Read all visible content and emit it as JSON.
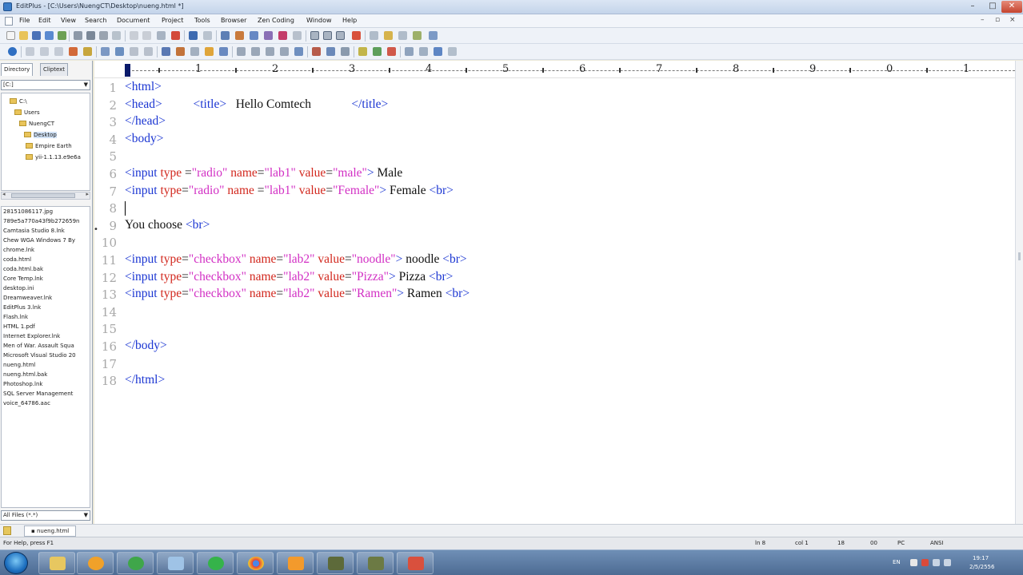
{
  "window": {
    "title": "EditPlus - [C:\\Users\\NuengCT\\Desktop\\nueng.html *]",
    "minimize": "–",
    "maximize": "□",
    "close": "✕"
  },
  "menu": [
    "File",
    "Edit",
    "View",
    "Search",
    "Document",
    "Project",
    "Tools",
    "Browser",
    "Zen Coding",
    "Window",
    "Help"
  ],
  "panel": {
    "tabs": [
      "Directory",
      "Cliptext"
    ],
    "drive": "[C:]",
    "tree": [
      {
        "label": "C:\\",
        "indent": 0
      },
      {
        "label": "Users",
        "indent": 1
      },
      {
        "label": "NuengCT",
        "indent": 2
      },
      {
        "label": "Desktop",
        "indent": 3
      },
      {
        "label": "Empire Earth",
        "indent": 4
      },
      {
        "label": "yii-1.1.13.e9e6a",
        "indent": 4
      }
    ],
    "files": [
      "28151086117.jpg",
      "789e5a770a43f9b272659n",
      "Camtasia Studio 8.lnk",
      "Chew WGA Windows 7 By",
      "chrome.lnk",
      "coda.html",
      "coda.html.bak",
      "Core Temp.lnk",
      "desktop.ini",
      "Dreamweaver.lnk",
      "EditPlus 3.lnk",
      "Flash.lnk",
      "HTML 1.pdf",
      "Internet Explorer.lnk",
      "Men of War. Assault Squa",
      "Microsoft Visual Studio 20",
      "nueng.html",
      "nueng.html.bak",
      "Photoshop.lnk",
      "SQL Server Management",
      "voice_64786.aac"
    ],
    "filter": "All Files (*.*)"
  },
  "editor": {
    "ruler": [
      "1",
      "2",
      "3",
      "4",
      "5",
      "6",
      "7",
      "8",
      "9",
      "0",
      "1"
    ],
    "lines": [
      {
        "n": "1",
        "segs": [
          [
            "t",
            "<html>"
          ]
        ]
      },
      {
        "n": "2",
        "segs": [
          [
            "t",
            "<head>"
          ],
          [
            "",
            "          "
          ],
          [
            "t",
            "<title>"
          ],
          [
            "",
            "   Hello Comtech             "
          ],
          [
            "t",
            "</title>"
          ]
        ]
      },
      {
        "n": "3",
        "segs": [
          [
            "t",
            "</head>"
          ]
        ]
      },
      {
        "n": "4",
        "segs": [
          [
            "t",
            "<body>"
          ]
        ]
      },
      {
        "n": "5",
        "segs": []
      },
      {
        "n": "6",
        "segs": [
          [
            "t",
            "<input "
          ],
          [
            "a",
            "type"
          ],
          [
            "",
            " ="
          ],
          [
            "v",
            "\"radio\""
          ],
          [
            "",
            " "
          ],
          [
            "a",
            "name"
          ],
          [
            "",
            "="
          ],
          [
            "v",
            "\"lab1\""
          ],
          [
            "",
            " "
          ],
          [
            "a",
            "value"
          ],
          [
            "",
            "="
          ],
          [
            "v",
            "\"male\""
          ],
          [
            "t",
            ">"
          ],
          [
            "",
            " Male"
          ]
        ]
      },
      {
        "n": "7",
        "segs": [
          [
            "t",
            "<input "
          ],
          [
            "a",
            "type"
          ],
          [
            "",
            "="
          ],
          [
            "v",
            "\"radio\""
          ],
          [
            "",
            " "
          ],
          [
            "a",
            "name"
          ],
          [
            "",
            " ="
          ],
          [
            "v",
            "\"lab1\""
          ],
          [
            "",
            " "
          ],
          [
            "a",
            "value"
          ],
          [
            "",
            "="
          ],
          [
            "v",
            "\"Female\""
          ],
          [
            "t",
            ">"
          ],
          [
            "",
            " Female "
          ],
          [
            "t",
            "<br>"
          ]
        ]
      },
      {
        "n": "8",
        "segs": []
      },
      {
        "n": "9",
        "segs": [
          [
            "",
            "You choose "
          ],
          [
            "t",
            "<br>"
          ]
        ]
      },
      {
        "n": "10",
        "segs": []
      },
      {
        "n": "11",
        "segs": [
          [
            "t",
            "<input "
          ],
          [
            "a",
            "type"
          ],
          [
            "",
            "="
          ],
          [
            "v",
            "\"checkbox\""
          ],
          [
            "",
            " "
          ],
          [
            "a",
            "name"
          ],
          [
            "",
            "="
          ],
          [
            "v",
            "\"lab2\""
          ],
          [
            "",
            " "
          ],
          [
            "a",
            "value"
          ],
          [
            "",
            "="
          ],
          [
            "v",
            "\"noodle\""
          ],
          [
            "t",
            ">"
          ],
          [
            "",
            " noodle "
          ],
          [
            "t",
            "<br>"
          ]
        ]
      },
      {
        "n": "12",
        "segs": [
          [
            "t",
            "<input "
          ],
          [
            "a",
            "type"
          ],
          [
            "",
            "="
          ],
          [
            "v",
            "\"checkbox\""
          ],
          [
            "",
            " "
          ],
          [
            "a",
            "name"
          ],
          [
            "",
            "="
          ],
          [
            "v",
            "\"lab2\""
          ],
          [
            "",
            " "
          ],
          [
            "a",
            "value"
          ],
          [
            "",
            "="
          ],
          [
            "v",
            "\"Pizza\""
          ],
          [
            "t",
            ">"
          ],
          [
            "",
            " Pizza "
          ],
          [
            "t",
            "<br>"
          ]
        ]
      },
      {
        "n": "13",
        "segs": [
          [
            "t",
            "<input "
          ],
          [
            "a",
            "type"
          ],
          [
            "",
            "="
          ],
          [
            "v",
            "\"checkbox\""
          ],
          [
            "",
            " "
          ],
          [
            "a",
            "name"
          ],
          [
            "",
            "="
          ],
          [
            "v",
            "\"lab2\""
          ],
          [
            "",
            " "
          ],
          [
            "a",
            "value"
          ],
          [
            "",
            "="
          ],
          [
            "v",
            "\"Ramen\""
          ],
          [
            "t",
            ">"
          ],
          [
            "",
            " Ramen "
          ],
          [
            "t",
            "<br>"
          ]
        ]
      },
      {
        "n": "14",
        "segs": []
      },
      {
        "n": "15",
        "segs": []
      },
      {
        "n": "16",
        "segs": [
          [
            "t",
            "</body>"
          ]
        ]
      },
      {
        "n": "17",
        "segs": []
      },
      {
        "n": "18",
        "segs": [
          [
            "t",
            "</html>"
          ]
        ]
      }
    ]
  },
  "doc_tab": "nueng.html",
  "status": {
    "help": "For Help, press F1",
    "line": "ln 8",
    "col": "col 1",
    "n1": "18",
    "n2": "00",
    "mode": "PC",
    "encoding": "ANSI"
  },
  "taskbar": {
    "apps": [
      "explorer",
      "media-player",
      "utorrent",
      "virtual-pc",
      "line",
      "chrome",
      "orange-app",
      "tank-game",
      "game-2",
      "editplus"
    ],
    "tray_lang": "EN",
    "time": "19:17",
    "date": "2/5/2556"
  },
  "colors": {
    "tag": "#1a35d2",
    "attr": "#d2281e",
    "value": "#d22fc4",
    "text": "#111111"
  }
}
